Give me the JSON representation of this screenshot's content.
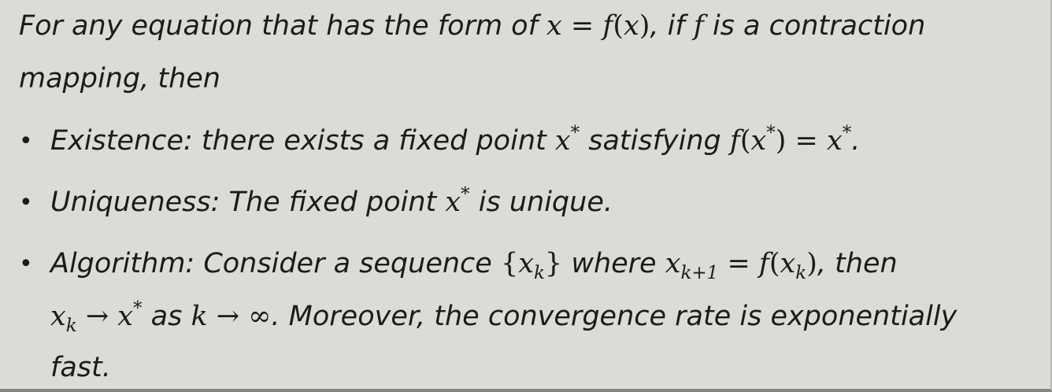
{
  "intro": {
    "part1": "For any equation that has the form of ",
    "eq_lhs": "x",
    "eq_sign": " = ",
    "eq_f": "f",
    "eq_open": "(",
    "eq_x": "x",
    "eq_close": ")",
    "part2": ", if ",
    "f": "f",
    "part3": " is a contraction",
    "line2": "mapping, then"
  },
  "bullets": [
    {
      "label": "Existence: there exists a fixed point ",
      "x": "x",
      "star": "*",
      "mid": " satisfying ",
      "f": "f",
      "open": "(",
      "x2": "x",
      "star2": "*",
      "close": ") = ",
      "x3": "x",
      "star3": "*",
      "end": "."
    },
    {
      "label": "Uniqueness: The fixed point ",
      "x": "x",
      "star": "*",
      "end": " is unique."
    },
    {
      "label": "Algorithm: Consider a sequence ",
      "seq_open": "{",
      "seq_x": "x",
      "seq_k": "k",
      "seq_close": "}",
      "where": " where ",
      "x_next": "x",
      "sub_next": "k+1",
      "eq": " = ",
      "f": "f",
      "open": "(",
      "x_k": "x",
      "sub_k": "k",
      "close": ")",
      "then": ", then",
      "line2_x": "x",
      "line2_sub": "k",
      "arrow": " → ",
      "line2_x2": "x",
      "line2_star": "*",
      "as": " as ",
      "k": "k",
      "arrow2": " → ∞",
      "moreover": ". Moreover, the convergence rate is exponentially",
      "line3": "fast."
    }
  ],
  "bullet_symbol": "•"
}
